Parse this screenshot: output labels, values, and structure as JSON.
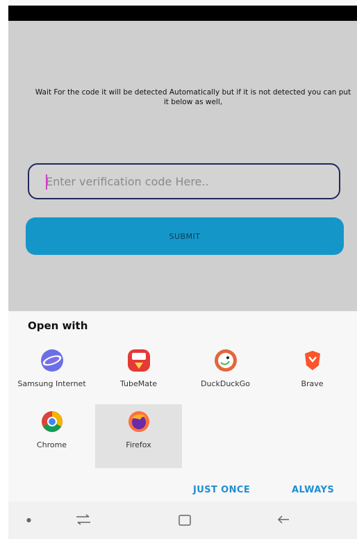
{
  "verify": {
    "instructions": "Wait For the code it will be detected Automatically but if it is not detected you can put it below as well,",
    "input_placeholder": "Enter verification code Here..",
    "submit_label": "SUBMIT"
  },
  "chooser": {
    "title": "Open with",
    "apps": [
      {
        "label": "Samsung Internet",
        "icon": "samsung-internet-icon"
      },
      {
        "label": "TubeMate",
        "icon": "tubemate-icon"
      },
      {
        "label": "DuckDuckGo",
        "icon": "duckduckgo-icon"
      },
      {
        "label": "Brave",
        "icon": "brave-icon"
      },
      {
        "label": "Chrome",
        "icon": "chrome-icon"
      },
      {
        "label": "Firefox",
        "icon": "firefox-icon",
        "selected": true
      }
    ],
    "just_once_label": "JUST ONCE",
    "always_label": "ALWAYS"
  },
  "nav": {
    "icons": [
      "dot-icon",
      "recent-apps-icon",
      "home-icon",
      "back-icon"
    ]
  },
  "colors": {
    "accent": "#1596c9",
    "button_text": "#1f8fd0",
    "input_border": "#1f2a5a"
  }
}
